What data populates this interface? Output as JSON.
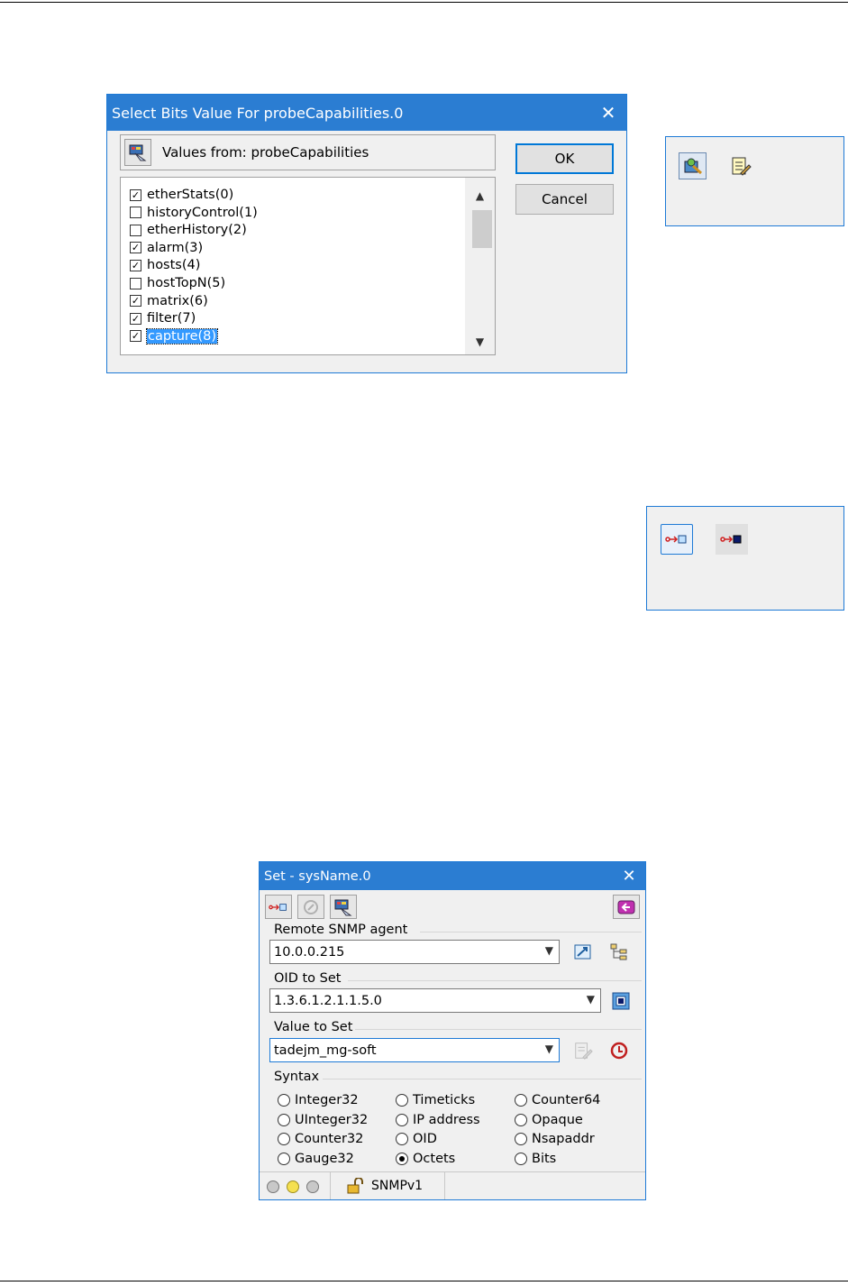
{
  "bits_dialog": {
    "title": "Select Bits Value For probeCapabilities.0",
    "close_glyph": "✕",
    "values_from_label": "Values from: probeCapabilities",
    "items": [
      {
        "label": "etherStats(0)",
        "checked": true
      },
      {
        "label": "historyControl(1)",
        "checked": false
      },
      {
        "label": "etherHistory(2)",
        "checked": false
      },
      {
        "label": "alarm(3)",
        "checked": true
      },
      {
        "label": "hosts(4)",
        "checked": true
      },
      {
        "label": "hostTopN(5)",
        "checked": false
      },
      {
        "label": "matrix(6)",
        "checked": true
      },
      {
        "label": "filter(7)",
        "checked": true
      },
      {
        "label": "capture(8)",
        "checked": true,
        "selected": true
      }
    ],
    "ok_label": "OK",
    "cancel_label": "Cancel"
  },
  "icon_box_1": {
    "icons": [
      "select-values-icon",
      "edit-value-icon"
    ]
  },
  "icon_box_2": {
    "icons": [
      "set-request-icon",
      "set-request-pressed-icon"
    ]
  },
  "set_dialog": {
    "title": "Set - sysName.0",
    "close_glyph": "✕",
    "toolbar": [
      "set-request-icon",
      "refresh-icon",
      "select-values-icon",
      "close-window-icon"
    ],
    "remote_agent_label": "Remote SNMP agent",
    "remote_agent_value": "10.0.0.215",
    "oid_label": "OID to Set",
    "oid_value": "1.3.6.1.2.1.1.5.0",
    "value_label": "Value to Set",
    "value_value": "tadejm_mg-soft",
    "syntax_label": "Syntax",
    "syntax_options": [
      [
        "Integer32",
        "Timeticks",
        "Counter64"
      ],
      [
        "UInteger32",
        "IP address",
        "Opaque"
      ],
      [
        "Counter32",
        "OID",
        "Nsapaddr"
      ],
      [
        "Gauge32",
        "Octets",
        "Bits"
      ]
    ],
    "syntax_selected": "Octets",
    "status_protocol": "SNMPv1"
  },
  "colors": {
    "title_bar": "#2b7dd2",
    "selection": "#3399ff",
    "border": "#1e7ad6"
  }
}
